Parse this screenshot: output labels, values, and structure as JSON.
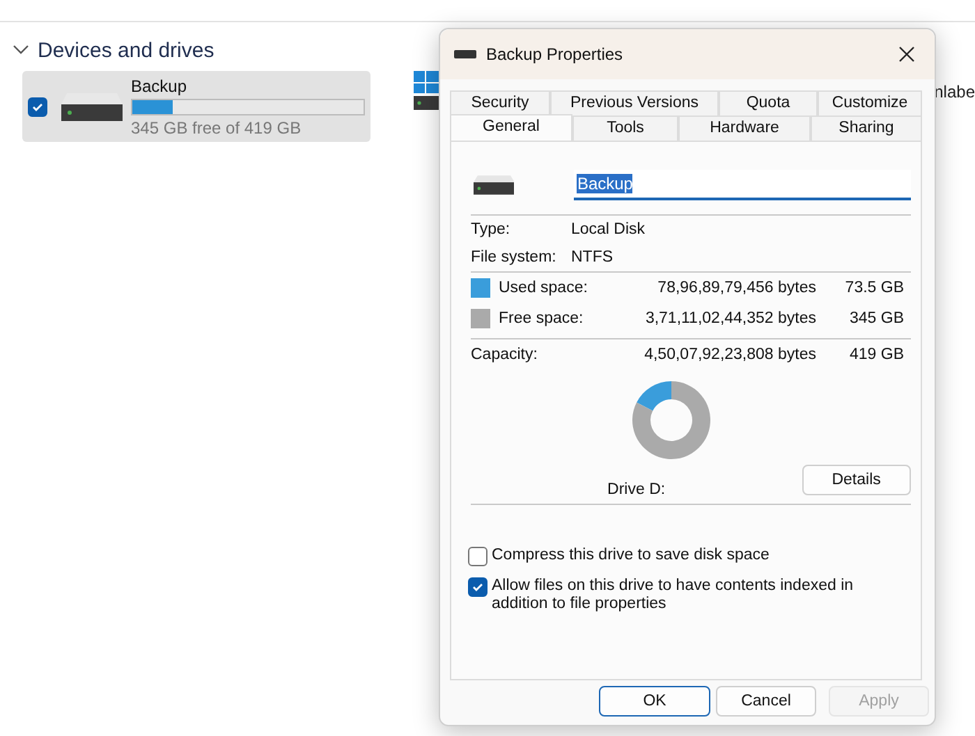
{
  "explorer": {
    "section": {
      "label": "Devices and drives",
      "expanded": true
    },
    "drives": [
      {
        "kind": "tile",
        "name": "Backup",
        "checked": true,
        "level": 0.175,
        "caption": "345 GB free of 419 GB"
      },
      {
        "kind": "partial",
        "name": "nlabe"
      }
    ]
  },
  "dialog": {
    "title": "Backup Properties",
    "tab_rows": [
      [
        {
          "label": "Security",
          "selected": false
        },
        {
          "label": "Previous Versions",
          "selected": false
        },
        {
          "label": "Quota",
          "selected": false
        },
        {
          "label": "Customize",
          "selected": false
        }
      ],
      [
        {
          "label": "General",
          "selected": true
        },
        {
          "label": "Tools",
          "selected": false
        },
        {
          "label": "Hardware",
          "selected": false
        },
        {
          "label": "Sharing",
          "selected": false
        }
      ]
    ],
    "name_value": "Backup",
    "info": [
      {
        "label": "Type:",
        "value": "Local Disk"
      },
      {
        "label": "File system:",
        "value": "NTFS"
      }
    ],
    "space": [
      {
        "label": "Used space:",
        "bytes": "78,96,89,79,456 bytes",
        "size": "73.5 GB",
        "color": "#3a9ddb"
      },
      {
        "label": "Free space:",
        "bytes": "3,71,11,02,44,352 bytes",
        "size": "345 GB",
        "color": "#aaaaaa"
      }
    ],
    "capacity": {
      "label": "Capacity:",
      "bytes": "4,50,07,92,23,808 bytes",
      "size": "419 GB"
    },
    "usage": {
      "level": 0.175
    },
    "drive_label": "Drive D:",
    "details_button": "Details",
    "options": [
      {
        "label": "Compress this drive to save disk space",
        "checked": false
      },
      {
        "label": "Allow files on this drive to have contents indexed in addition to file properties",
        "checked": true
      }
    ],
    "buttons": [
      {
        "label": "OK",
        "kind": "default"
      },
      {
        "label": "Cancel",
        "kind": "normal"
      },
      {
        "label": "Apply",
        "kind": "disabled"
      }
    ]
  }
}
